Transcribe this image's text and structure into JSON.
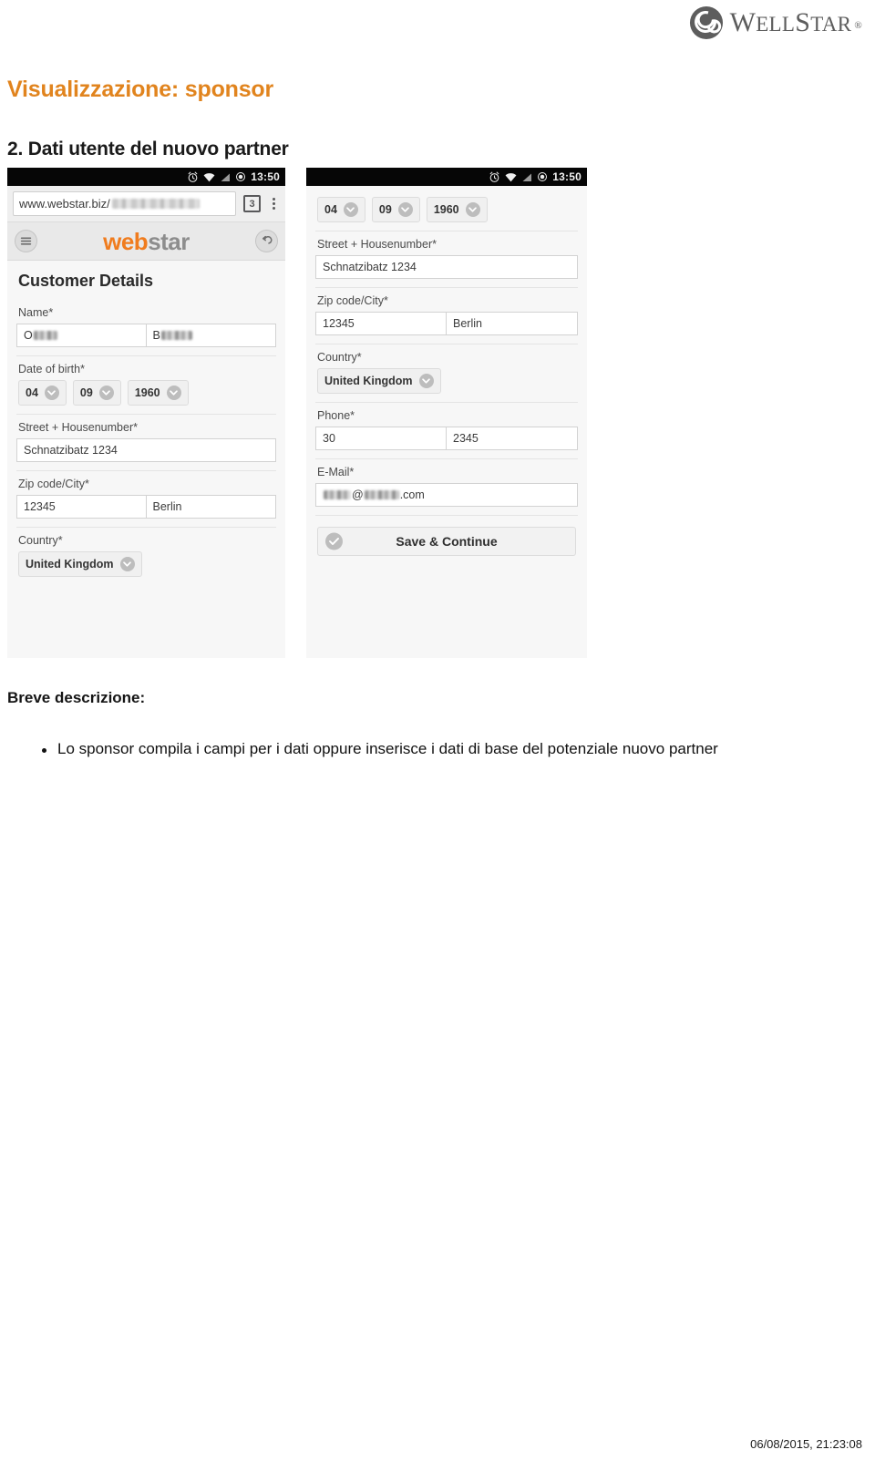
{
  "brand": {
    "logo_name": "wellstar-logo",
    "logo_text_well": "W",
    "logo_text_ell": "ELL",
    "logo_text_s": "S",
    "logo_text_tar": "TAR",
    "registered_mark": "®",
    "colors": {
      "accent_orange": "#E1841E",
      "logo_gray": "#5d5d5d",
      "webstar_orange": "#F07C1E"
    }
  },
  "page_title": "Visualizzazione: sponsor",
  "section_title": "2. Dati utente del nuovo partner",
  "phone_left": {
    "statusbar": {
      "time": "13:50",
      "icons": [
        "alarm-icon",
        "wifi-icon",
        "signal-icon",
        "battery-icon"
      ]
    },
    "browser": {
      "url_prefix": "www.webstar.biz/",
      "url_redacted": true,
      "tab_count": "3",
      "menu": "overflow-menu"
    },
    "site_header": {
      "brand_first": "web",
      "brand_second": "star",
      "left_icon": "hamburger-icon",
      "right_icon": "back-arrow-icon"
    },
    "form": {
      "title": "Customer Details",
      "name": {
        "label": "Name*",
        "first_visible": "O",
        "last_visible": "B",
        "redacted": true
      },
      "dob": {
        "label": "Date of birth*",
        "day": "04",
        "month": "09",
        "year": "1960"
      },
      "street": {
        "label": "Street + Housenumber*",
        "value": "Schnatzibatz 1234"
      },
      "zip_city": {
        "label": "Zip code/City*",
        "zip": "12345",
        "city": "Berlin"
      },
      "country": {
        "label": "Country*",
        "value": "United Kingdom"
      }
    }
  },
  "phone_right": {
    "statusbar": {
      "time": "13:50",
      "icons": [
        "alarm-icon",
        "wifi-icon",
        "signal-icon",
        "battery-icon"
      ]
    },
    "form": {
      "dob": {
        "day": "04",
        "month": "09",
        "year": "1960"
      },
      "street": {
        "label": "Street + Housenumber*",
        "value": "Schnatzibatz 1234"
      },
      "zip_city": {
        "label": "Zip code/City*",
        "zip": "12345",
        "city": "Berlin"
      },
      "country": {
        "label": "Country*",
        "value": "United Kingdom"
      },
      "phone": {
        "label": "Phone*",
        "prefix": "30",
        "number": "2345"
      },
      "email": {
        "label": "E-Mail*",
        "suffix": ".com",
        "at": "@",
        "redacted": true
      },
      "submit": {
        "label": "Save & Continue",
        "icon": "check-circle-icon"
      }
    }
  },
  "description": {
    "heading": "Breve descrizione:",
    "bullets": [
      "Lo sponsor compila i campi per i dati oppure inserisce i dati di base del potenziale nuovo partner"
    ]
  },
  "footer": {
    "timestamp": "06/08/2015, 21:23:08"
  }
}
